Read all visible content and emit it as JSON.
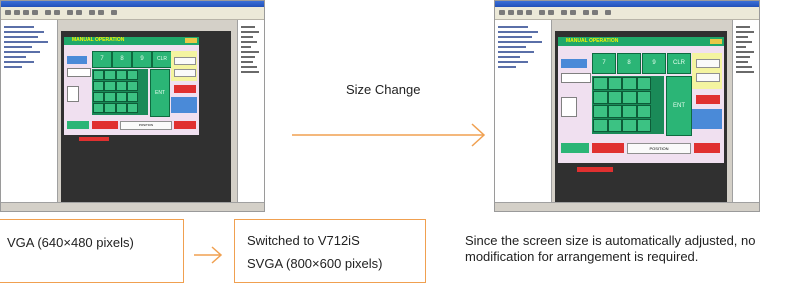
{
  "screenshot_left": {
    "panel_title": "MANUAL OPERATION",
    "keys": [
      "7",
      "8",
      "9",
      "CLR"
    ],
    "enter": "ENT",
    "bottom_label": "POSITION"
  },
  "screenshot_right": {
    "panel_title": "MANUAL OPERATION",
    "keys": [
      "7",
      "8",
      "9",
      "CLR"
    ],
    "enter": "ENT",
    "bottom_label": "POSITION"
  },
  "size_change": "Size Change",
  "left_box": "VGA (640×480 pixels)",
  "right_box_line1": "Switched to V712iS",
  "right_box_line2": "SVGA (800×600 pixels)",
  "note": "Since the screen size is automatically adjusted, no modification for arrangement is required.",
  "colors": {
    "accent": "#f0a050",
    "panel_green": "#2bb576",
    "canvas": "#303030"
  }
}
